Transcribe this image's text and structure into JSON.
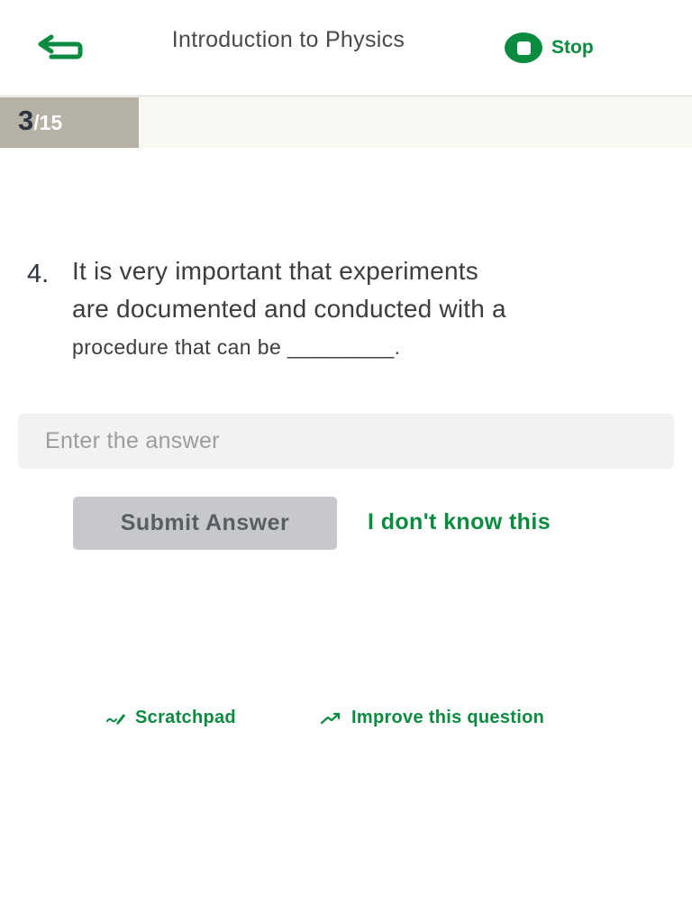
{
  "header": {
    "title": "Introduction to Physics",
    "stop_label": "Stop"
  },
  "progress": {
    "current": "3",
    "total": "/15",
    "fraction": 0.2
  },
  "question": {
    "number": "4.",
    "line1": "It is very important that experiments",
    "line2": "are documented and conducted with a",
    "line3": "procedure that can be _________."
  },
  "answer": {
    "placeholder": "Enter the answer",
    "value": ""
  },
  "actions": {
    "submit_label": "Submit Answer",
    "dont_know_label": "I don't know this"
  },
  "footer": {
    "scratchpad_label": "Scratchpad",
    "improve_label": "Improve this question"
  },
  "icons": {
    "back": "back-arrow-icon",
    "stop": "stop-icon",
    "scratchpad": "pencil-icon",
    "improve": "trending-up-icon"
  },
  "colors": {
    "accent": "#0a8b3f",
    "progress_fill": "#b6b1a5",
    "progress_track": "#f8f7f2",
    "button_disabled": "#c7c8cc"
  }
}
